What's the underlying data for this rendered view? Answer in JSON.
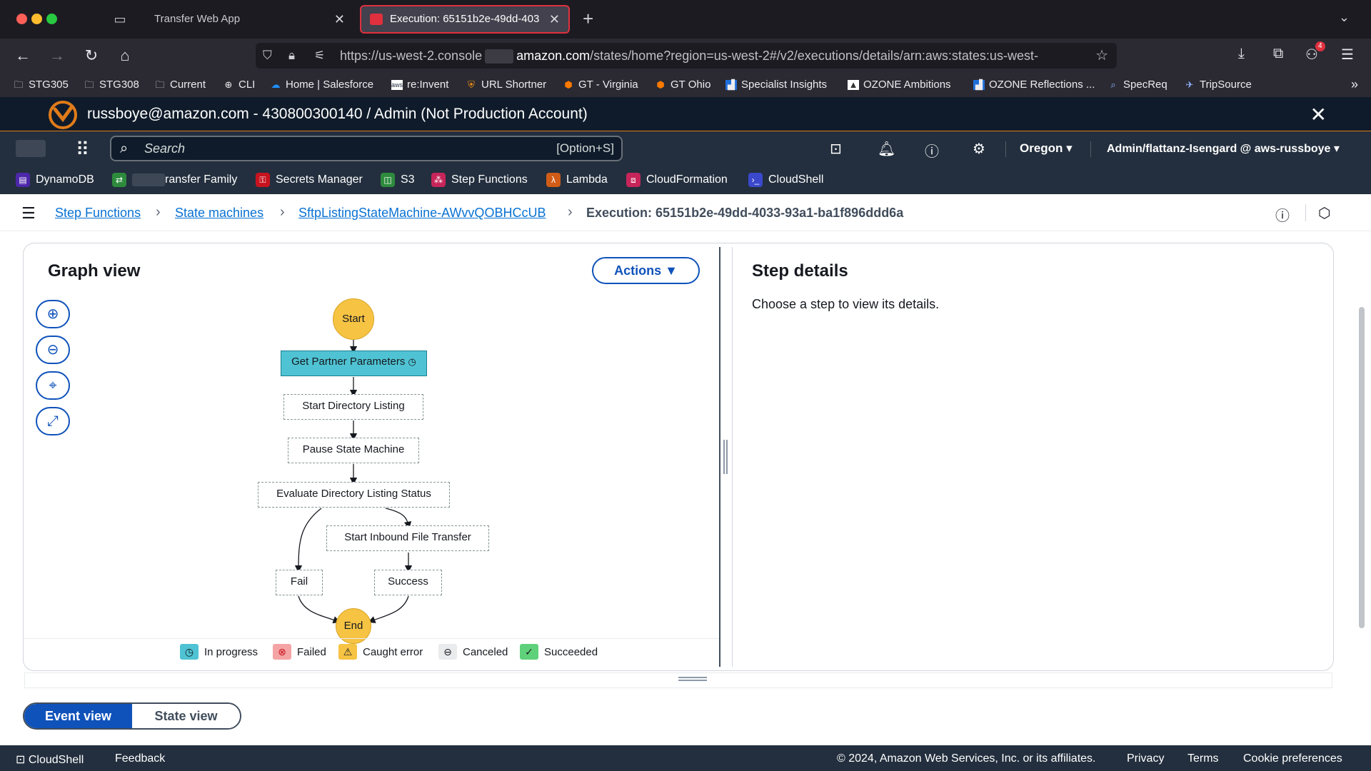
{
  "browser": {
    "tabs": [
      {
        "title": "Transfer Web App",
        "active": false
      },
      {
        "title": "Execution: 65151b2e-49dd-403",
        "active": true
      }
    ],
    "url": {
      "prefix": "https://us-west-2.console",
      "host": "amazon.com",
      "path": "/states/home?region=us-west-2#/v2/executions/details/arn:aws:states:us-west-"
    },
    "downloads_badge": "4",
    "bookmarks": [
      {
        "label": "STG305",
        "icon": "folder-icon"
      },
      {
        "label": "STG308",
        "icon": "folder-icon"
      },
      {
        "label": "Current",
        "icon": "folder-icon"
      },
      {
        "label": "CLI",
        "icon": "globe-icon"
      },
      {
        "label": "Home | Salesforce",
        "icon": "cloud-icon"
      },
      {
        "label": "re:Invent",
        "icon": "aws-icon"
      },
      {
        "label": "URL Shortner",
        "icon": "shield-icon"
      },
      {
        "label": "GT - Virginia",
        "icon": "cube-icon"
      },
      {
        "label": "GT Ohio",
        "icon": "cube-icon"
      },
      {
        "label": "Specialist Insights",
        "icon": "chart-icon"
      },
      {
        "label": "OZONE Ambitions",
        "icon": "image-icon"
      },
      {
        "label": "OZONE Reflections ...",
        "icon": "chart-icon"
      },
      {
        "label": "SpecReq",
        "icon": "search-icon"
      },
      {
        "label": "TripSource",
        "icon": "plane-icon"
      }
    ]
  },
  "account_banner": {
    "text": "russboye@amazon.com - 430800300140 / Admin (Not Production Account)"
  },
  "aws_nav": {
    "search_placeholder": "Search",
    "search_shortcut": "[Option+S]",
    "region": "Oregon",
    "user": "Admin/flattanz-Isengard @ aws-russboye",
    "favorites": [
      {
        "label": "DynamoDB",
        "color": "#4d27aa"
      },
      {
        "label": "ransfer Family",
        "color": "#2e8b3d",
        "masked_prefix": true
      },
      {
        "label": "Secrets Manager",
        "color": "#c7131f"
      },
      {
        "label": "S3",
        "color": "#2e8b3d"
      },
      {
        "label": "Step Functions",
        "color": "#c7255a"
      },
      {
        "label": "Lambda",
        "color": "#d05c17"
      },
      {
        "label": "CloudFormation",
        "color": "#c7255a"
      },
      {
        "label": "CloudShell",
        "color": "#3b48cc"
      }
    ]
  },
  "breadcrumb": {
    "items": [
      "Step Functions",
      "State machines",
      "SftpListingStateMachine-AWvvQOBHCcUB"
    ],
    "current": "Execution: 65151b2e-49dd-4033-93a1-ba1f896ddd6a"
  },
  "graph": {
    "title": "Graph view",
    "actions_label": "Actions",
    "nodes": {
      "start": "Start",
      "get_partner": "Get Partner Parameters",
      "start_listing": "Start Directory Listing",
      "pause": "Pause State Machine",
      "evaluate": "Evaluate Directory Listing Status",
      "inbound": "Start Inbound File Transfer",
      "fail": "Fail",
      "success": "Success",
      "end": "End"
    },
    "legend": [
      {
        "label": "In progress",
        "color": "#4fc3d3"
      },
      {
        "label": "Failed",
        "color": "#f4a4a4"
      },
      {
        "label": "Caught error",
        "color": "#f6c343"
      },
      {
        "label": "Canceled",
        "color": "#e9ebed"
      },
      {
        "label": "Succeeded",
        "color": "#5fd17a"
      }
    ]
  },
  "step_details": {
    "title": "Step details",
    "description": "Choose a step to view its details."
  },
  "view_toggle": {
    "event": "Event view",
    "state": "State view",
    "selected": "Event view"
  },
  "footer": {
    "cloudshell": "CloudShell",
    "feedback": "Feedback",
    "copyright": "© 2024, Amazon Web Services, Inc. or its affiliates.",
    "privacy": "Privacy",
    "terms": "Terms",
    "cookies": "Cookie preferences"
  }
}
